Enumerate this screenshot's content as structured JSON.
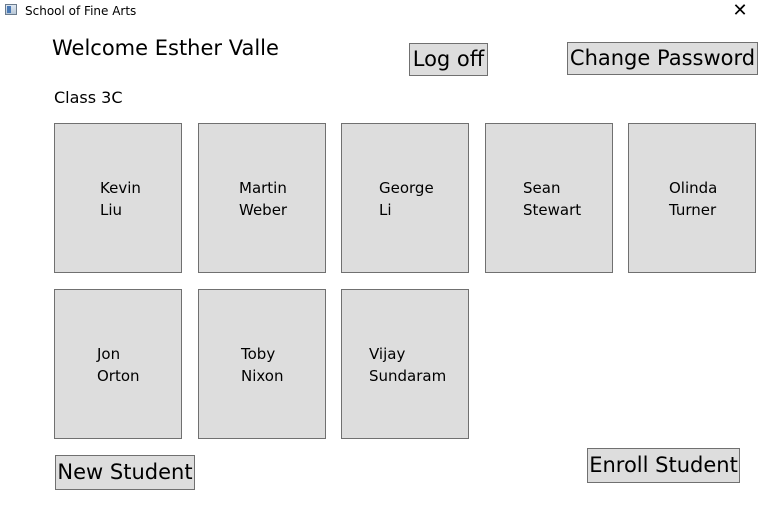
{
  "window": {
    "title": "School of Fine Arts",
    "close_glyph": "✕",
    "icon": "app-window-icon"
  },
  "header": {
    "welcome": "Welcome Esther Valle",
    "logoff_label": "Log off",
    "change_password_label": "Change Password"
  },
  "class_label": "Class 3C",
  "students": [
    {
      "first": "Kevin",
      "last": "Liu"
    },
    {
      "first": "Martin",
      "last": "Weber"
    },
    {
      "first": "George",
      "last": "Li"
    },
    {
      "first": "Sean",
      "last": "Stewart"
    },
    {
      "first": "Olinda",
      "last": "Turner"
    },
    {
      "first": "Jon",
      "last": "Orton"
    },
    {
      "first": "Toby",
      "last": "Nixon"
    },
    {
      "first": "Vijay",
      "last": "Sundaram"
    }
  ],
  "footer": {
    "new_student_label": "New Student",
    "enroll_student_label": "Enroll Student"
  },
  "colors": {
    "tile_background": "#dddddd",
    "border": "#707070",
    "window_background": "#ffffff"
  }
}
